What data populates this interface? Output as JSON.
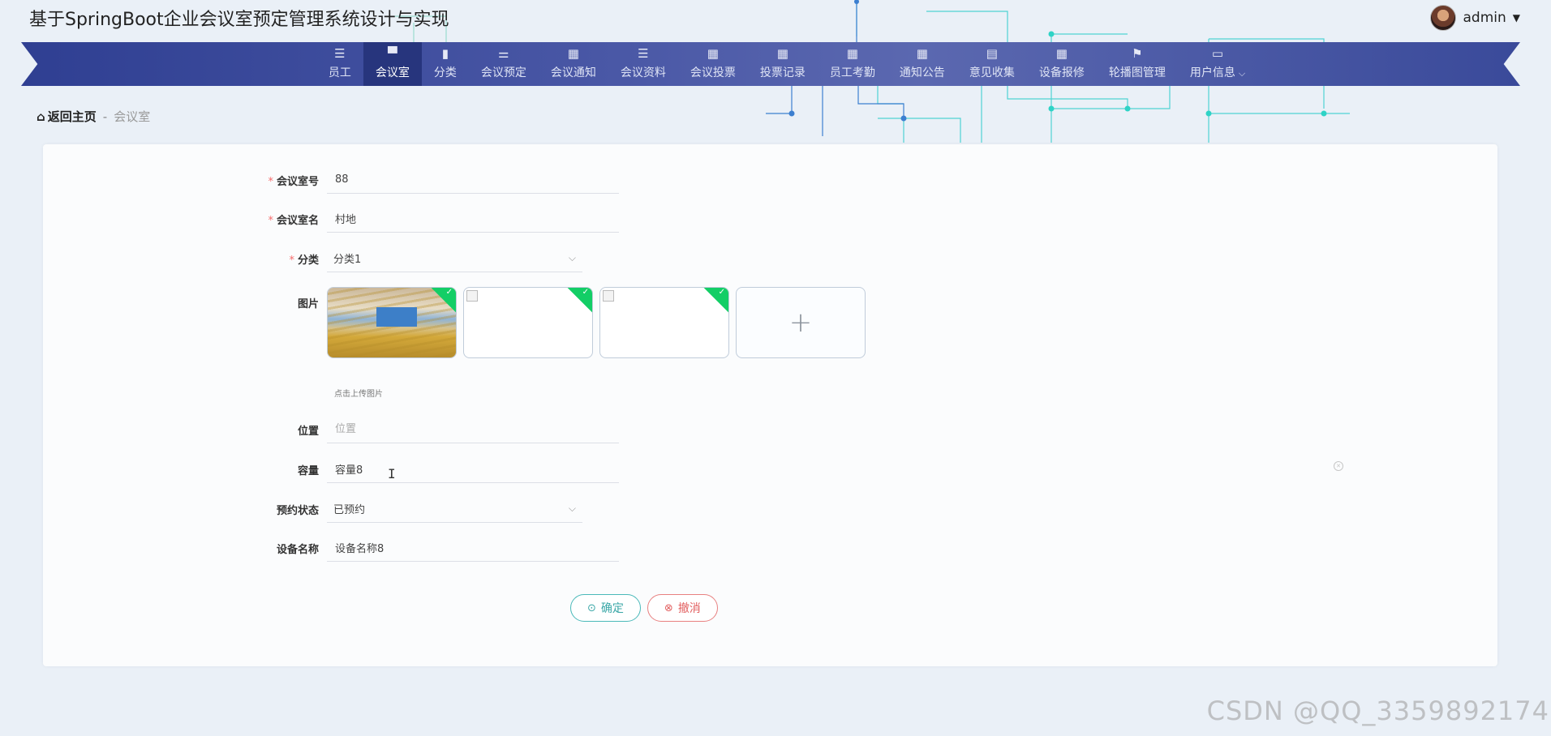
{
  "app": {
    "title": "基于SpringBoot企业会议室预定管理系统设计与实现",
    "user": "admin",
    "watermark": "CSDN @QQ_3359892174"
  },
  "nav": {
    "items": [
      {
        "label": "员工",
        "icon": "list-icon",
        "glyph": "☰"
      },
      {
        "label": "会议室",
        "icon": "chair-icon",
        "glyph": "▀"
      },
      {
        "label": "分类",
        "icon": "bar-chart-icon",
        "glyph": "▮"
      },
      {
        "label": "会议预定",
        "icon": "sliders-icon",
        "glyph": "⚌"
      },
      {
        "label": "会议通知",
        "icon": "grid-icon",
        "glyph": "▦"
      },
      {
        "label": "会议资料",
        "icon": "list-icon",
        "glyph": "☰"
      },
      {
        "label": "会议投票",
        "icon": "grid-icon",
        "glyph": "▦"
      },
      {
        "label": "投票记录",
        "icon": "grid-icon",
        "glyph": "▦"
      },
      {
        "label": "员工考勤",
        "icon": "grid-icon",
        "glyph": "▦"
      },
      {
        "label": "通知公告",
        "icon": "grid-icon",
        "glyph": "▦"
      },
      {
        "label": "意见收集",
        "icon": "briefcase-icon",
        "glyph": "▤"
      },
      {
        "label": "设备报修",
        "icon": "grid-icon",
        "glyph": "▦"
      },
      {
        "label": "轮播图管理",
        "icon": "flag-icon",
        "glyph": "⚑"
      },
      {
        "label": "用户信息",
        "icon": "card-icon",
        "glyph": "▭"
      }
    ]
  },
  "breadcrumb": {
    "home": "返回主页",
    "separator": "-",
    "current": "会议室"
  },
  "form": {
    "room_no": {
      "label": "会议室号",
      "value": "88"
    },
    "room_name": {
      "label": "会议室名",
      "value": "村地"
    },
    "category": {
      "label": "分类",
      "value": "分类1"
    },
    "image": {
      "label": "图片",
      "tip": "点击上传图片",
      "add": "+"
    },
    "location": {
      "label": "位置",
      "value": "",
      "placeholder": "位置"
    },
    "capacity": {
      "label": "容量",
      "value": "容量8"
    },
    "status": {
      "label": "预约状态",
      "value": "已预约"
    },
    "device": {
      "label": "设备名称",
      "value": "设备名称8"
    }
  },
  "buttons": {
    "ok": "确定",
    "cancel": "撤消"
  },
  "colors": {
    "nav_active": "#27357d",
    "required": "#f56c6c",
    "success": "#13ce66",
    "ok_button": "#3aa7a7",
    "cancel_button": "#e26060"
  }
}
